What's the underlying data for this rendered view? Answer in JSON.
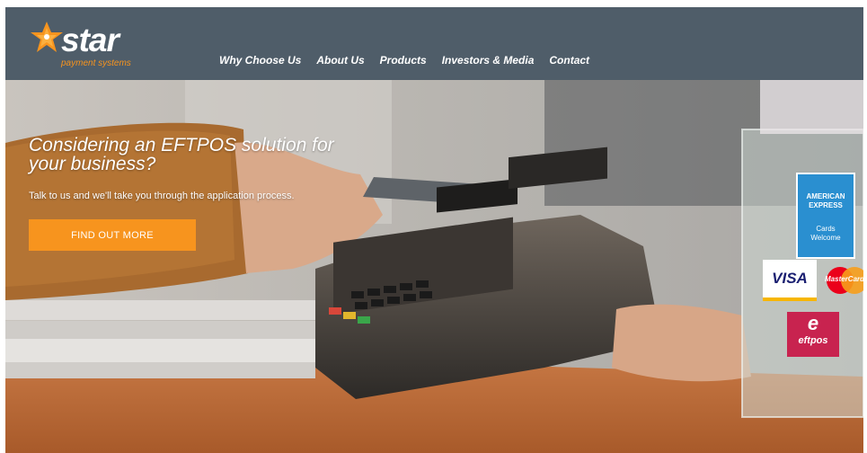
{
  "brand": {
    "name": "star",
    "tagline": "payment systems"
  },
  "nav": {
    "items": [
      "Why Choose Us",
      "About Us",
      "Products",
      "Investors & Media",
      "Contact"
    ]
  },
  "hero": {
    "headline": "Considering an EFTPOS solution for your business?",
    "subline": "Talk to us and we'll take you through the application process.",
    "cta_label": "FIND OUT MORE"
  },
  "card_logos": {
    "amex_line1": "AMERICAN",
    "amex_line2": "EXPRESS",
    "amex_line3": "Cards",
    "amex_line4": "Welcome",
    "visa": "VISA",
    "mastercard": "MasterCard",
    "eftpos": "eftpos"
  },
  "colors": {
    "header_bg": "#4f5d69",
    "accent": "#f7941e",
    "nav_text": "#ffffff"
  }
}
